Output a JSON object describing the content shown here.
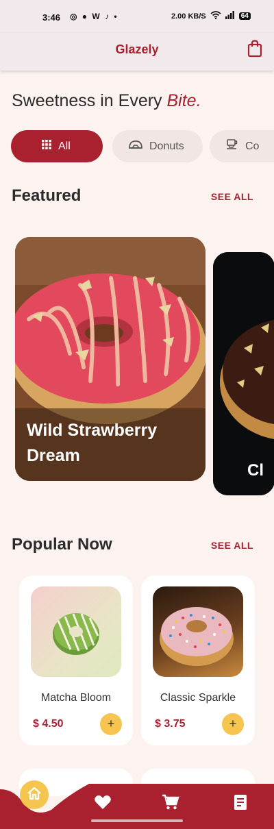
{
  "status_bar": {
    "time": "3:46",
    "left_icons": "◎ ● W ♪ •",
    "network_speed": "2.00 KB/S",
    "battery": "64"
  },
  "header": {
    "title": "Glazely",
    "cart_icon": "shopping-bag-icon"
  },
  "headline": {
    "main": "Sweetness in Every ",
    "accent": "Bite."
  },
  "categories": [
    {
      "label": "All",
      "icon": "grid-icon",
      "selected": true
    },
    {
      "label": "Donuts",
      "icon": "donut-icon",
      "selected": false
    },
    {
      "label": "Co",
      "icon": "coffee-cup-icon",
      "selected": false
    }
  ],
  "featured": {
    "title": "Featured",
    "see_all": "SEE ALL",
    "items": [
      {
        "name": "Wild Strawberry Dream"
      },
      {
        "name": "Cl"
      }
    ]
  },
  "popular": {
    "title": "Popular Now",
    "see_all": "SEE ALL",
    "items": [
      {
        "name": "Matcha Bloom",
        "price": "$ 4.50",
        "add": "+"
      },
      {
        "name": "Classic Sparkle",
        "price": "$ 3.75",
        "add": "+"
      }
    ]
  },
  "bottom_nav": {
    "items": [
      "home-icon",
      "heart-icon",
      "cart-icon",
      "orders-icon"
    ]
  },
  "colors": {
    "brand": "#a9212e",
    "accent_yellow": "#f6c550",
    "background": "#fcf3f0"
  }
}
